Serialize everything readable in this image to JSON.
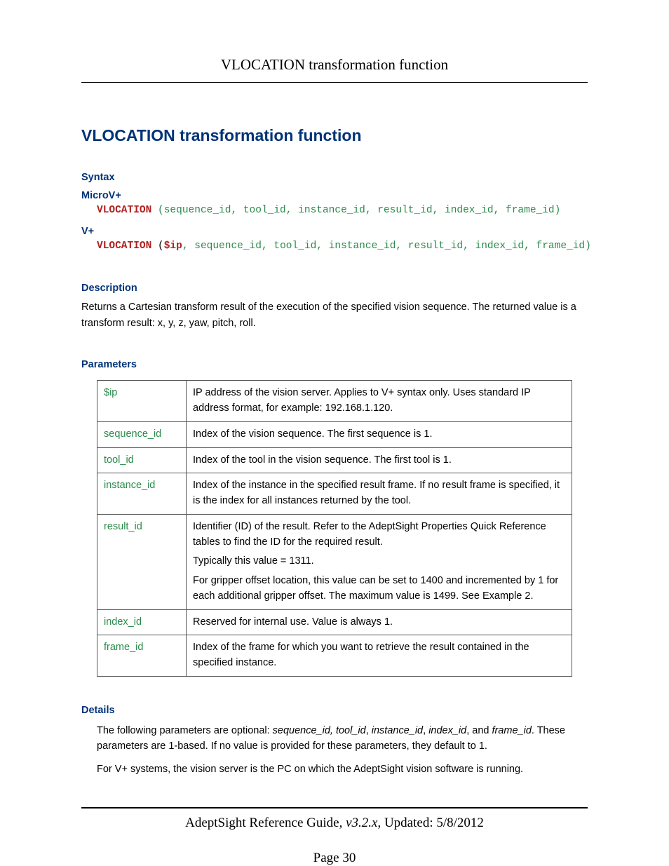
{
  "header": {
    "title": "VLOCATION transformation function"
  },
  "main_heading": "VLOCATION transformation function",
  "syntax": {
    "heading": "Syntax",
    "microv_label": "MicroV+",
    "vplus_label": "V+",
    "keyword": "VLOCATION",
    "ip_arg": "$ip",
    "args_microv": " (sequence_id, tool_id, instance_id, result_id, index_id, frame_id)",
    "vplus_open": " (",
    "vplus_rest": ", sequence_id, tool_id, instance_id, result_id, index_id, frame_id)"
  },
  "description": {
    "heading": "Description",
    "text": "Returns a Cartesian transform result of the execution of the specified vision sequence. The returned value is a transform result: x, y, z, yaw, pitch, roll."
  },
  "parameters": {
    "heading": "Parameters",
    "rows": [
      {
        "name": "$ip",
        "desc": "IP address of the vision server. Applies to V+ syntax only. Uses standard IP address format, for example: 192.168.1.120."
      },
      {
        "name": "sequence_id",
        "desc": "Index of the vision sequence. The first sequence is 1."
      },
      {
        "name": "tool_id",
        "desc": "Index of the tool in the vision sequence. The first tool is 1."
      },
      {
        "name": "instance_id",
        "desc": "Index of the instance in the specified result frame. If no result frame is specified, it is the index for all instances returned by the tool."
      },
      {
        "name": "result_id",
        "desc_multi": [
          "Identifier (ID) of the result. Refer to the AdeptSight Properties Quick Reference tables to find the ID for the required result.",
          "Typically this value = 1311.",
          "For gripper offset location, this value can be set to 1400 and incremented by 1 for each additional gripper offset. The maximum value is 1499. See Example 2."
        ]
      },
      {
        "name": "index_id",
        "desc": "Reserved for internal use. Value is always 1."
      },
      {
        "name": "frame_id",
        "desc": "Index of the frame for which you want to retrieve the result contained in the specified instance."
      }
    ]
  },
  "details": {
    "heading": "Details",
    "p1_a": "The following parameters are optional: ",
    "p1_i1": "sequence_id, tool_id",
    "p1_b": ", ",
    "p1_i2": "instance_id",
    "p1_c": ", ",
    "p1_i3": "index_id",
    "p1_d": ", and ",
    "p1_i4": "frame_id",
    "p1_e": ". These parameters are 1-based. If no value is provided for these parameters, they default to 1.",
    "p2": "For V+ systems, the vision server is the PC on which the AdeptSight vision software is running."
  },
  "footer": {
    "guide": "AdeptSight Reference Guide",
    "version": ", v3.2.x",
    "updated": ", Updated: 5/8/2012",
    "page": "Page 30"
  }
}
